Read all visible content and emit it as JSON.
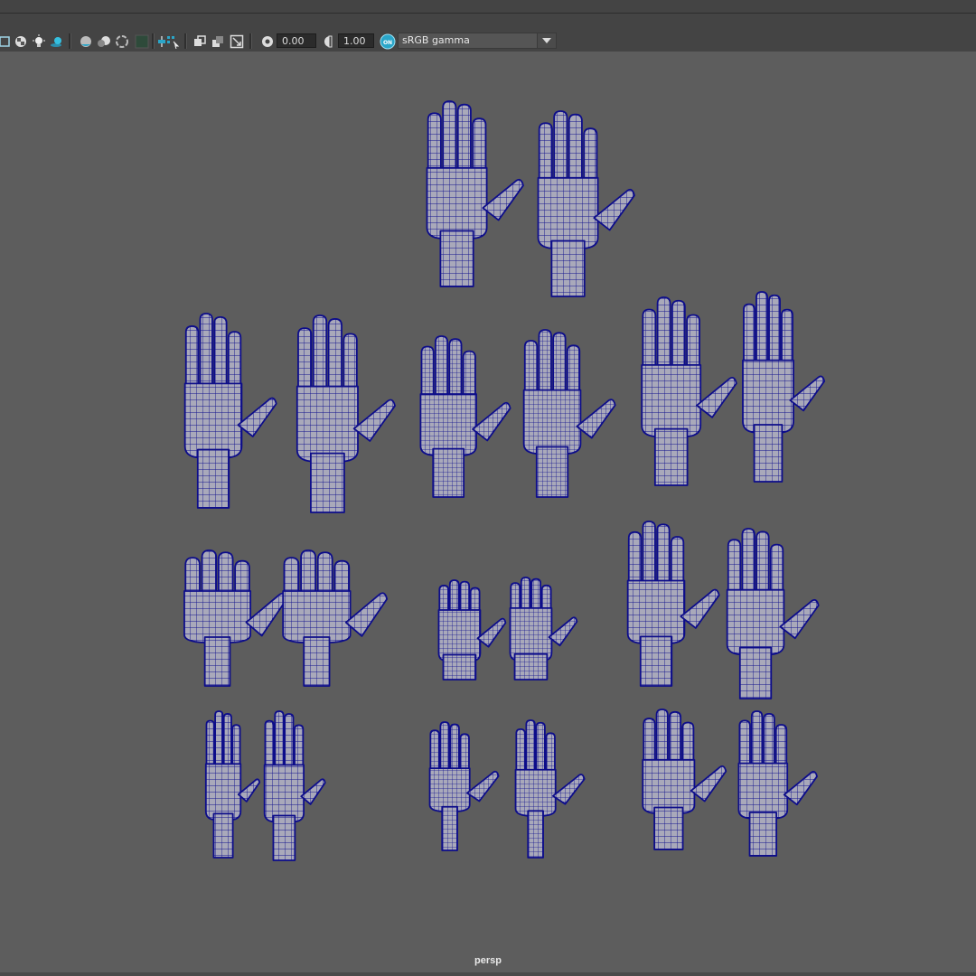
{
  "toolbar": {
    "exposure_value": "0.00",
    "gamma_value": "1.00",
    "color_management_badge": "ON",
    "color_space": "sRGB gamma",
    "colors": {
      "accent": "#2aa6c9",
      "bar": "#444444",
      "field": "#2b2b2b"
    },
    "icons": [
      "camera-attributes-icon",
      "checker-icon",
      "light-icon",
      "shadows-icon",
      "ambient-occlusion-icon",
      "motion-blur-icon",
      "anti-aliasing-icon",
      "depth-of-field-icon",
      "isolate-select-icon",
      "xray-icon",
      "xray-joints-icon",
      "wireframe-on-shaded-icon",
      "backface-culling-icon",
      "resolution-gate-icon",
      "exposure-icon",
      "gamma-icon",
      "color-management-icon"
    ]
  },
  "viewport": {
    "camera_label": "persp",
    "background": "#5d5d5d",
    "wire_color": "#0d0d8a",
    "mesh_color": "#a6a6b6",
    "hand_models": [
      {
        "group": "row-1",
        "variant": "adult-long"
      },
      {
        "group": "row-1",
        "variant": "adult-long"
      },
      {
        "group": "row-2",
        "variant": "adult-wide"
      },
      {
        "group": "row-2",
        "variant": "adult-wide"
      },
      {
        "group": "row-2",
        "variant": "adult-cuffed"
      },
      {
        "group": "row-2",
        "variant": "adult-cuffed"
      },
      {
        "group": "row-2",
        "variant": "adult-square"
      },
      {
        "group": "row-2",
        "variant": "adult-square"
      },
      {
        "group": "row-3",
        "variant": "cartoon-chubby"
      },
      {
        "group": "row-3",
        "variant": "cartoon-chubby"
      },
      {
        "group": "row-3",
        "variant": "child-small"
      },
      {
        "group": "row-3",
        "variant": "child-small"
      },
      {
        "group": "row-3",
        "variant": "adult-spread"
      },
      {
        "group": "row-3",
        "variant": "adult-spread"
      },
      {
        "group": "row-4",
        "variant": "slim-long"
      },
      {
        "group": "row-4",
        "variant": "slim-long"
      },
      {
        "group": "row-4",
        "variant": "cartoon-thin"
      },
      {
        "group": "row-4",
        "variant": "cartoon-thin"
      },
      {
        "group": "row-4",
        "variant": "stylized-cupped"
      },
      {
        "group": "row-4",
        "variant": "stylized-cupped"
      }
    ]
  }
}
